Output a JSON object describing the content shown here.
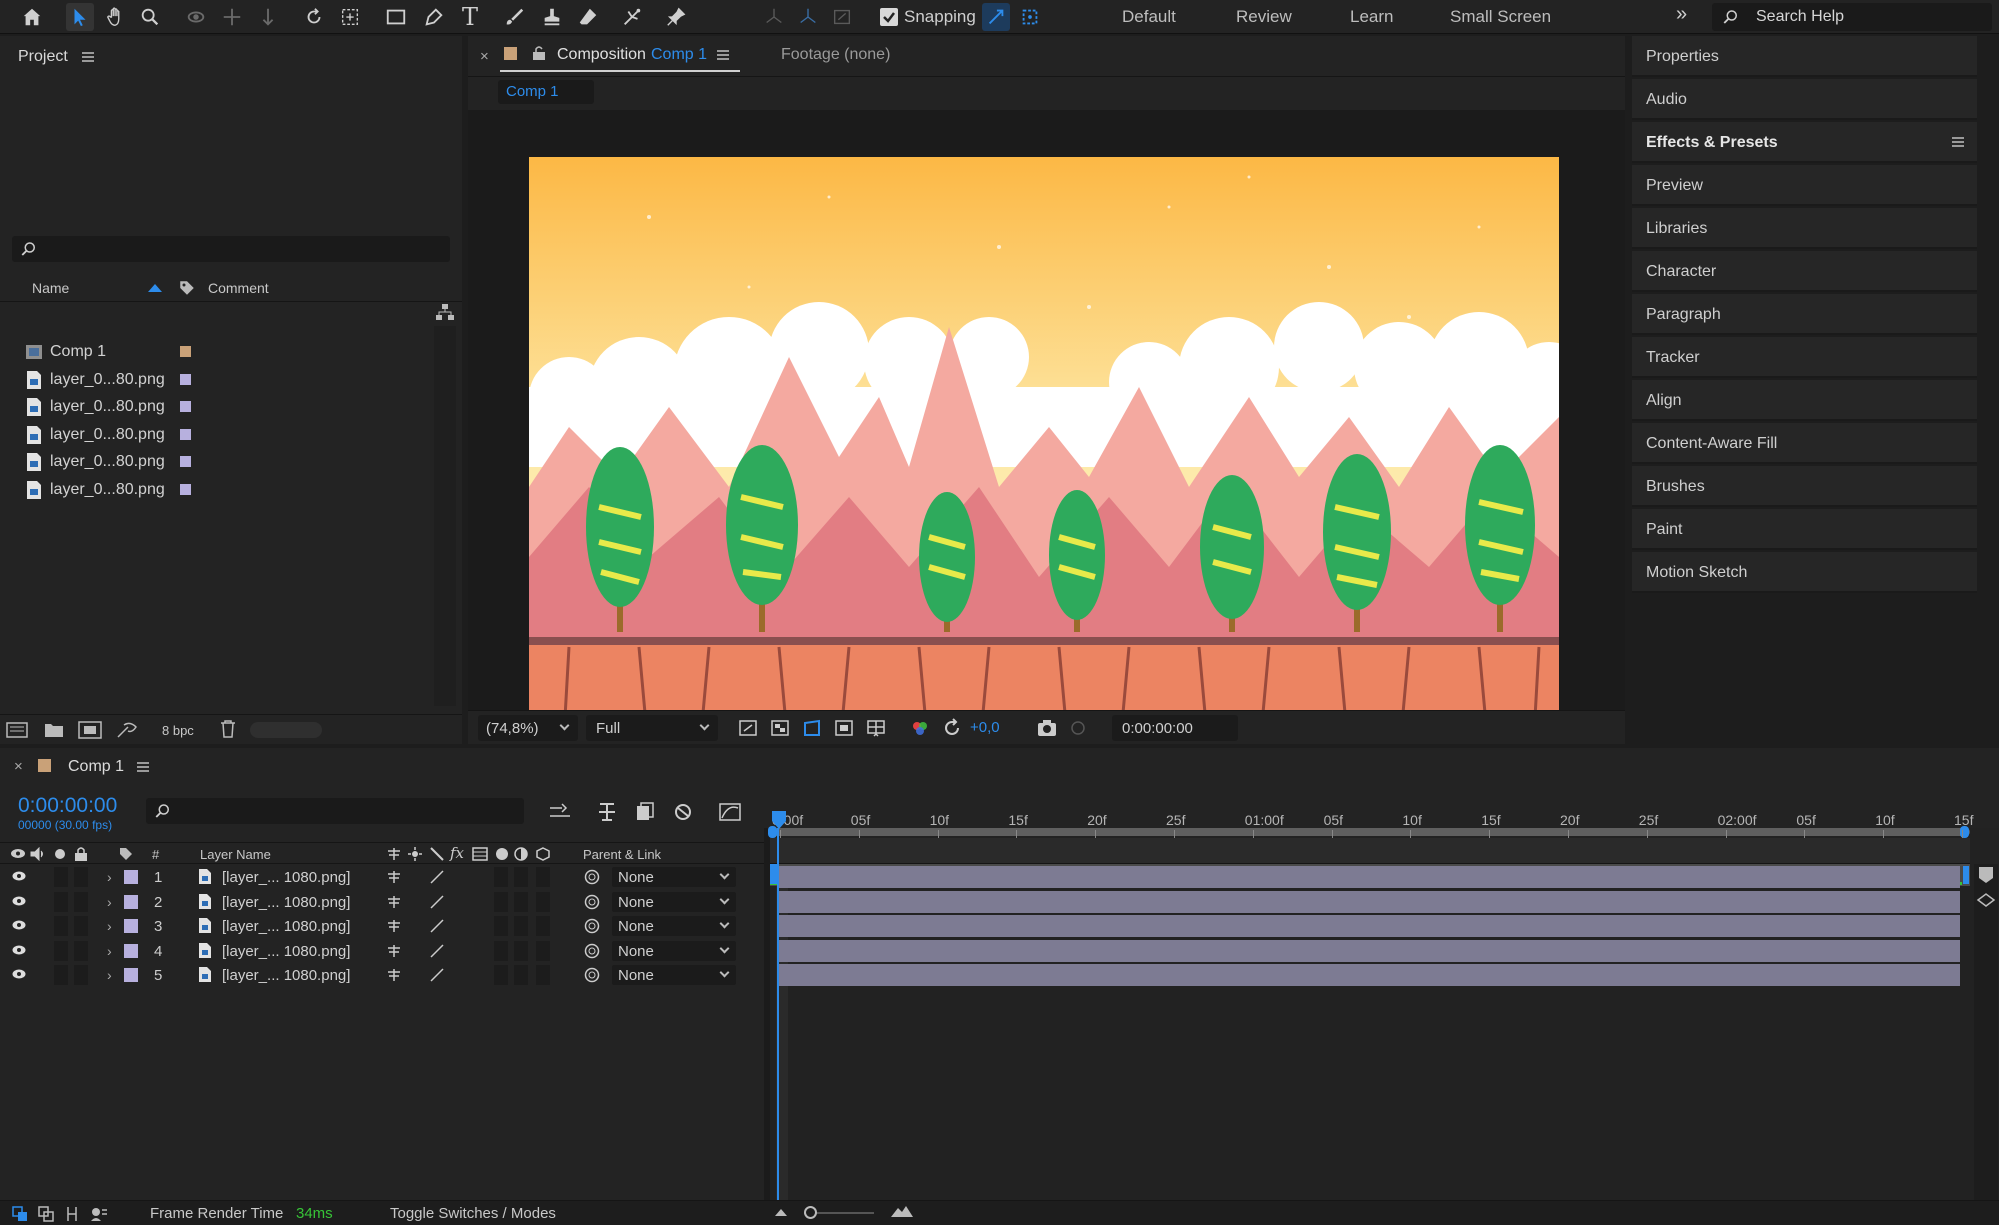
{
  "toolbar": {
    "snapping_label": "Snapping",
    "workspaces": [
      "Default",
      "Review",
      "Learn",
      "Small Screen"
    ],
    "search_placeholder": "Search Help",
    "icons": [
      "home-icon",
      "selection-tool-icon",
      "hand-tool-icon",
      "zoom-tool-icon",
      "orbit-camera-icon",
      "pan-camera-icon",
      "dolly-camera-icon",
      "rotation-tool-icon",
      "pan-behind-tool-icon",
      "rectangle-tool-icon",
      "pen-tool-icon",
      "type-tool-icon",
      "brush-tool-icon",
      "clone-stamp-icon",
      "eraser-tool-icon",
      "roto-brush-icon",
      "puppet-pin-icon"
    ]
  },
  "project": {
    "title": "Project",
    "columns": {
      "name": "Name",
      "comment": "Comment"
    },
    "items": [
      {
        "name": "Comp 1",
        "type": "comp",
        "label_color": "#c9a178"
      },
      {
        "name": "layer_0...80.png",
        "type": "file",
        "label_color": "#b7b0de"
      },
      {
        "name": "layer_0...80.png",
        "type": "file",
        "label_color": "#b7b0de"
      },
      {
        "name": "layer_0...80.png",
        "type": "file",
        "label_color": "#b7b0de"
      },
      {
        "name": "layer_0...80.png",
        "type": "file",
        "label_color": "#b7b0de"
      },
      {
        "name": "layer_0...80.png",
        "type": "file",
        "label_color": "#b7b0de"
      }
    ],
    "bpc": "8 bpc"
  },
  "composition": {
    "tab_prefix": "Composition",
    "tab_comp": "Comp 1",
    "footage_tab": "Footage (none)",
    "sub_tab": "Comp 1",
    "zoom": "(74,8%)",
    "resolution": "Full",
    "exposure": "+0,0",
    "timecode": "0:00:00:00"
  },
  "right_panel": {
    "items": [
      "Properties",
      "Audio",
      "Effects & Presets",
      "Preview",
      "Libraries",
      "Character",
      "Paragraph",
      "Tracker",
      "Align",
      "Content-Aware Fill",
      "Brushes",
      "Paint",
      "Motion Sketch"
    ],
    "active": "Effects & Presets"
  },
  "timeline": {
    "comp_name": "Comp 1",
    "current_time": "0:00:00:00",
    "frame_info": "00000 (30.00 fps)",
    "col_hash": "#",
    "col_layer_name": "Layer Name",
    "col_parent": "Parent & Link",
    "layers": [
      {
        "num": "1",
        "name": "[layer_... 1080.png]",
        "parent": "None"
      },
      {
        "num": "2",
        "name": "[layer_... 1080.png]",
        "parent": "None"
      },
      {
        "num": "3",
        "name": "[layer_... 1080.png]",
        "parent": "None"
      },
      {
        "num": "4",
        "name": "[layer_... 1080.png]",
        "parent": "None"
      },
      {
        "num": "5",
        "name": "[layer_... 1080.png]",
        "parent": "None"
      }
    ],
    "ruler": [
      "0:00f",
      "05f",
      "10f",
      "15f",
      "20f",
      "25f",
      "01:00f",
      "05f",
      "10f",
      "15f",
      "20f",
      "25f",
      "02:00f",
      "05f",
      "10f",
      "15f"
    ],
    "frame_render_label": "Frame Render Time",
    "frame_render_value": "34ms",
    "toggle_label": "Toggle Switches / Modes"
  },
  "colors": {
    "accent": "#2d8ceb",
    "work_area_green": "#37c437",
    "layer_bar": "#7d7b93"
  }
}
